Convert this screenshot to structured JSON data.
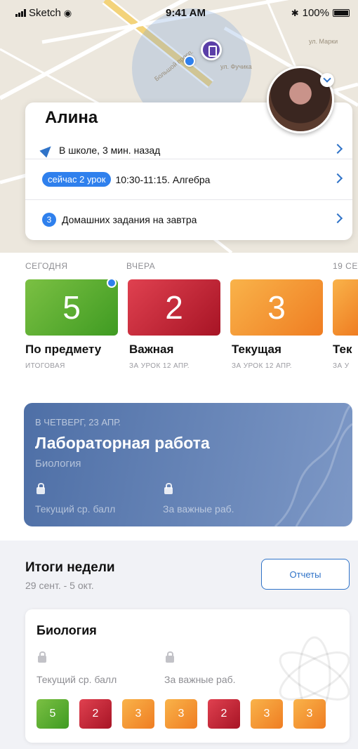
{
  "status_bar": {
    "carrier": "Sketch",
    "time": "9:41 AM",
    "battery": "100%"
  },
  "map": {
    "street_1": "Большой просп.",
    "street_2": "ул. Фучика",
    "street_3": "ул. Марки"
  },
  "profile": {
    "name": "Алина",
    "location_text": "В школе, 3 мин. назад",
    "lesson_badge": "сейчас 2 урок",
    "lesson_text": "10:30-11:15. Алгебра",
    "homework_count": "3",
    "homework_text": "Домашних задания на завтра"
  },
  "grades": {
    "labels": [
      "СЕГОДНЯ",
      "ВЧЕРА",
      "19 СЕ"
    ],
    "tiles": [
      {
        "value": "5",
        "title": "По предмету",
        "subtitle": "ИТОГОВАЯ",
        "color": "#5aae32"
      },
      {
        "value": "2",
        "title": "Важная",
        "subtitle": "ЗА УРОК 12 АПР.",
        "color": "#c41f33"
      },
      {
        "value": "3",
        "title": "Текущая",
        "subtitle": "ЗА УРОК 12 АПР.",
        "color": "#f39a34"
      },
      {
        "value": "",
        "title": "Тек",
        "subtitle": "ЗА У",
        "color": "#f39a34"
      }
    ]
  },
  "lab": {
    "date": "В ЧЕТВЕРГ, 23 АПР.",
    "title": "Лабораторная работа",
    "subject": "Биология",
    "metric_1": "Текущий ср. балл",
    "metric_2": "За важные раб."
  },
  "week": {
    "title": "Итоги недели",
    "range": "29 сент. - 5 окт.",
    "reports_label": "Отчеты",
    "subject": {
      "title": "Биология",
      "metric_1": "Текущий ср. балл",
      "metric_2": "За важные раб.",
      "marks": [
        "5",
        "2",
        "3",
        "3",
        "2",
        "3",
        "3"
      ]
    }
  },
  "colors": {
    "accent": "#2f73c8",
    "badge": "#2f80ed",
    "grade_5": "#5aae32",
    "grade_2": "#c41f33",
    "grade_3": "#f39a34"
  }
}
